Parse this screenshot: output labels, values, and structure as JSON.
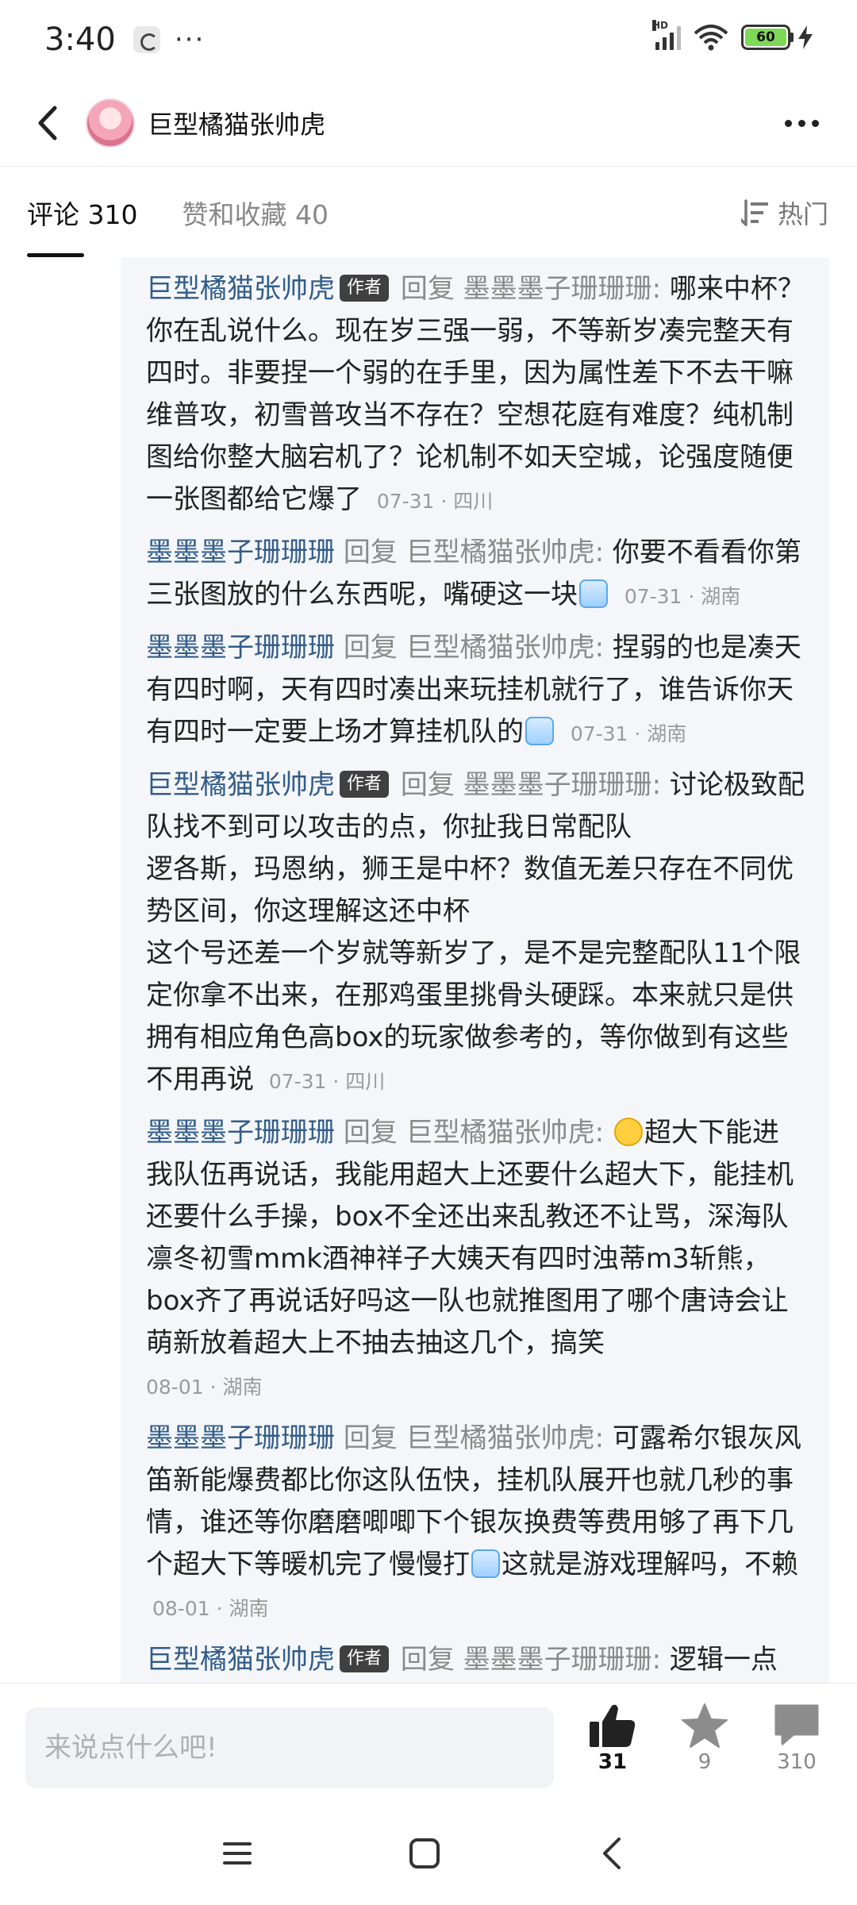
{
  "status": {
    "time": "3:40",
    "dots": "···",
    "network_label": "HD",
    "battery_level": "60",
    "battery_color": "#7ed957"
  },
  "header": {
    "title": "巨型橘猫张帅虎",
    "back_icon": "chevron-left-icon",
    "more_icon": "more-horizontal-icon"
  },
  "tabs": [
    {
      "label": "评论 310",
      "active": true
    },
    {
      "label": "赞和收藏 40",
      "active": false
    }
  ],
  "sort": {
    "label": "热门"
  },
  "comments": [
    {
      "author": "巨型橘猫张帅虎",
      "badge": "作者",
      "reply_word": "回复",
      "target": "墨墨墨子珊珊珊:",
      "text": "哪来中杯？你在乱说什么。现在岁三强一弱，不等新岁凑完整天有四时。非要捏一个弱的在手里，因为属性差下不去干嘛",
      "text2": "维普攻，初雪普攻当不存在？空想花庭有难度？纯机制图给你整大脑宕机了？论机制不如天空城，论强度随便一张图都给它爆了",
      "meta": "07-31 · 四川"
    },
    {
      "author": "墨墨墨子珊珊珊",
      "reply_word": "回复",
      "target": "巨型橘猫张帅虎:",
      "text": "你要不看看你第三张图放的什么东西呢，嘴硬这一块",
      "meta": "07-31 · 湖南"
    },
    {
      "author": "墨墨墨子珊珊珊",
      "reply_word": "回复",
      "target": "巨型橘猫张帅虎:",
      "text": "捏弱的也是凑天有四时啊，天有四时凑出来玩挂机就行了，谁告诉你天有四时一定要上场才算挂机队的",
      "meta": "07-31 · 湖南"
    },
    {
      "author": "巨型橘猫张帅虎",
      "badge": "作者",
      "reply_word": "回复",
      "target": "墨墨墨子珊珊珊:",
      "text": "讨论极致配队找不到可以攻击的点，你扯我日常配队",
      "text2": "逻各斯，玛恩纳，狮王是中杯？数值无差只存在不同优势区间，你这理解这还中杯",
      "text3": "这个号还差一个岁就等新岁了，是不是完整配队11个限定你拿不出来，在那鸡蛋里挑骨头硬踩。本来就只是供拥有相应角色高box的玩家做参考的，等你做到有这些不用再说",
      "meta": "07-31 · 四川"
    },
    {
      "author": "墨墨墨子珊珊珊",
      "reply_word": "回复",
      "target": "巨型橘猫张帅虎:",
      "text": "超大下能进我队伍再说话，我能用超大上还要什么超大下，能挂机还要什么手操，box不全还出来乱教还不让骂，深海队凛冬初雪mmk酒神祥子大姨天有四时浊蒂m3斩熊，box齐了再说话好吗这一队也就推图用了哪个唐诗会让萌新放着超大上不抽去抽这几个，搞笑",
      "meta": "08-01 · 湖南"
    },
    {
      "author": "墨墨墨子珊珊珊",
      "reply_word": "回复",
      "target": "巨型橘猫张帅虎:",
      "text": "可露希尔银灰风笛新能爆费都比你这队伍快，挂机队展开也就几秒的事情，谁还等你磨磨唧唧下个银灰换费等费用够了再下几个超大下等暖机完了慢慢打",
      "text_after": "这就是游戏理解吗，不赖",
      "meta": "08-01 · 湖南"
    },
    {
      "author": "巨型橘猫张帅虎",
      "badge": "作者",
      "reply_word": "回复",
      "target": "墨墨墨子珊珊珊:",
      "text": "逻辑一点"
    }
  ],
  "input": {
    "placeholder": "来说点什么吧!"
  },
  "actions": {
    "like_count": "31",
    "star_count": "9",
    "comment_count": "310"
  }
}
